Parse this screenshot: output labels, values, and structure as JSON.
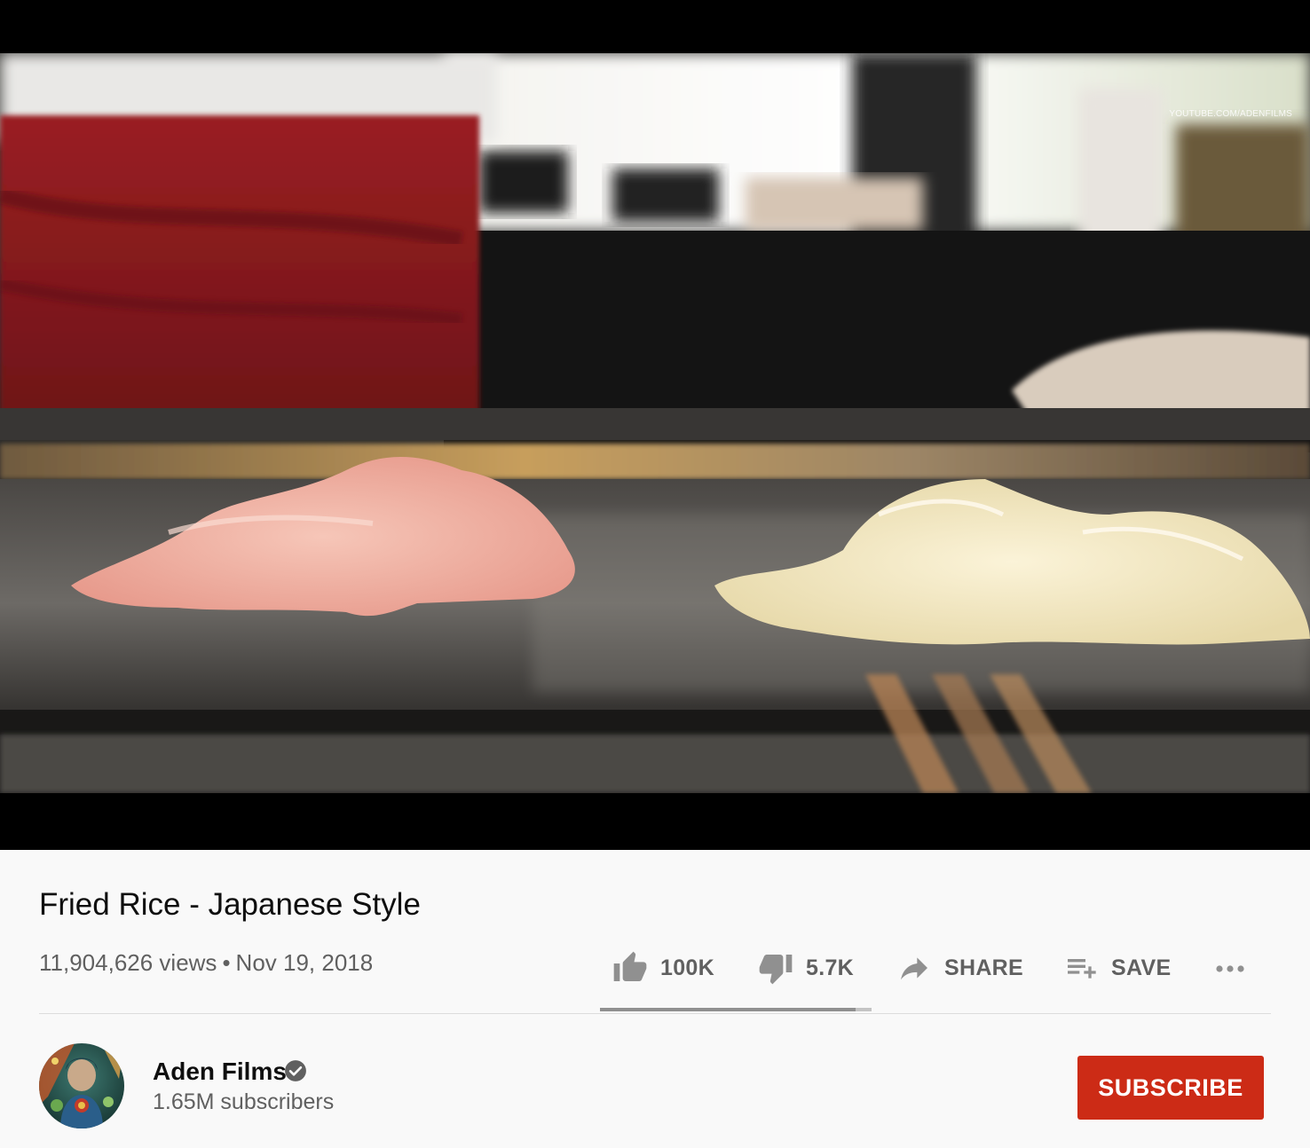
{
  "video": {
    "watermark": "YOUTUBE.COM/ADENFILMS"
  },
  "title": "Fried Rice - Japanese Style",
  "views": "11,904,626 views",
  "separator": "•",
  "date": "Nov 19, 2018",
  "actions": {
    "like_count": "100K",
    "dislike_count": "5.7K",
    "share_label": "SHARE",
    "save_label": "SAVE"
  },
  "like_ratio": 0.94,
  "channel": {
    "name": "Aden Films",
    "subscribers": "1.65M subscribers",
    "verified": true
  },
  "subscribe_label": "SUBSCRIBE",
  "colors": {
    "subscribe_bg": "#cc2b16",
    "meta_text": "#606060",
    "page_bg": "#f9f9f9"
  }
}
